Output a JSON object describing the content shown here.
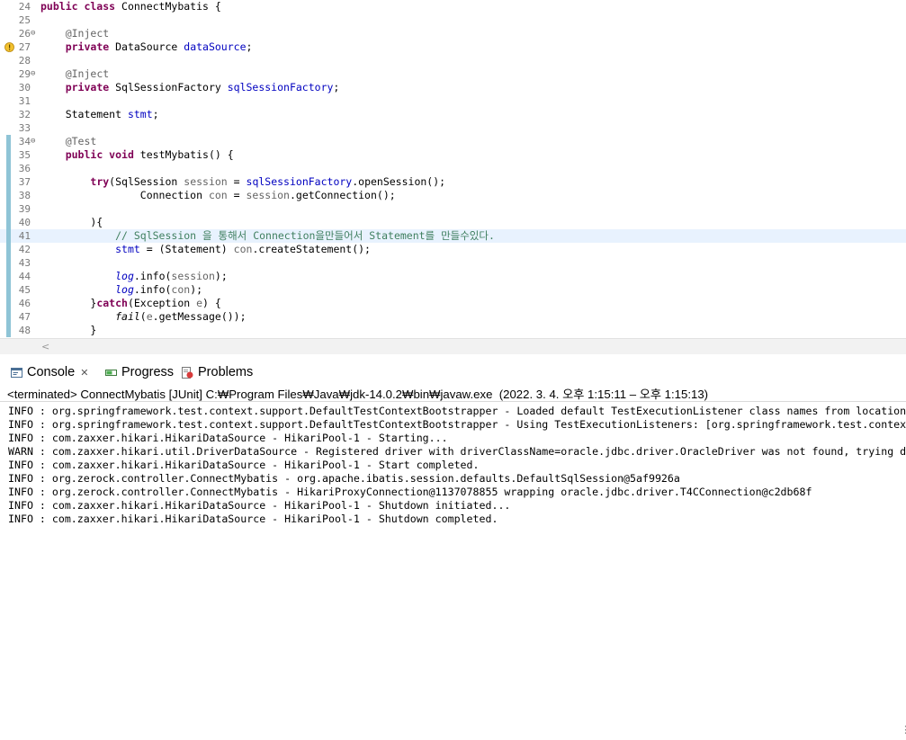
{
  "editor": {
    "lines": [
      {
        "n": "24",
        "parts": [
          {
            "t": "public class ",
            "c": "kw"
          },
          {
            "t": "ConnectMybatis {"
          }
        ]
      },
      {
        "n": "25",
        "parts": []
      },
      {
        "n": "26",
        "fold": "⊖",
        "parts": [
          {
            "t": "    "
          },
          {
            "t": "@Inject",
            "c": "ann"
          }
        ]
      },
      {
        "n": "27",
        "warn": true,
        "parts": [
          {
            "t": "    "
          },
          {
            "t": "private ",
            "c": "kw"
          },
          {
            "t": "DataSource "
          },
          {
            "t": "dataSource",
            "c": "fld"
          },
          {
            "t": ";"
          }
        ]
      },
      {
        "n": "28",
        "parts": []
      },
      {
        "n": "29",
        "fold": "⊖",
        "parts": [
          {
            "t": "    "
          },
          {
            "t": "@Inject",
            "c": "ann"
          }
        ]
      },
      {
        "n": "30",
        "parts": [
          {
            "t": "    "
          },
          {
            "t": "private ",
            "c": "kw"
          },
          {
            "t": "SqlSessionFactory "
          },
          {
            "t": "sqlSessionFactory",
            "c": "fld"
          },
          {
            "t": ";"
          }
        ]
      },
      {
        "n": "31",
        "parts": []
      },
      {
        "n": "32",
        "parts": [
          {
            "t": "    Statement "
          },
          {
            "t": "stmt",
            "c": "fld"
          },
          {
            "t": ";"
          }
        ]
      },
      {
        "n": "33",
        "parts": []
      },
      {
        "n": "34",
        "fold": "⊖",
        "mark": true,
        "parts": [
          {
            "t": "    "
          },
          {
            "t": "@Test",
            "c": "ann"
          }
        ]
      },
      {
        "n": "35",
        "mark": true,
        "parts": [
          {
            "t": "    "
          },
          {
            "t": "public void ",
            "c": "kw"
          },
          {
            "t": "testMybatis() {"
          }
        ]
      },
      {
        "n": "36",
        "mark": true,
        "parts": []
      },
      {
        "n": "37",
        "mark": true,
        "parts": [
          {
            "t": "        "
          },
          {
            "t": "try",
            "c": "kw"
          },
          {
            "t": "(SqlSession "
          },
          {
            "t": "session",
            "c": "ann"
          },
          {
            "t": " = "
          },
          {
            "t": "sqlSessionFactory",
            "c": "fld"
          },
          {
            "t": ".openSession();"
          }
        ]
      },
      {
        "n": "38",
        "mark": true,
        "parts": [
          {
            "t": "                Connection "
          },
          {
            "t": "con",
            "c": "ann"
          },
          {
            "t": " = "
          },
          {
            "t": "session",
            "c": "ann"
          },
          {
            "t": ".getConnection();"
          }
        ]
      },
      {
        "n": "39",
        "mark": true,
        "parts": []
      },
      {
        "n": "40",
        "mark": true,
        "parts": [
          {
            "t": "        ){"
          }
        ]
      },
      {
        "n": "41",
        "mark": true,
        "hl": true,
        "parts": [
          {
            "t": "            "
          },
          {
            "t": "// SqlSession 을 통해서 Connection을만들어서 Statement를 만들수있다.",
            "c": "cmt"
          }
        ]
      },
      {
        "n": "42",
        "mark": true,
        "parts": [
          {
            "t": "            "
          },
          {
            "t": "stmt",
            "c": "fld"
          },
          {
            "t": " = (Statement) "
          },
          {
            "t": "con",
            "c": "ann"
          },
          {
            "t": ".createStatement();"
          }
        ]
      },
      {
        "n": "43",
        "mark": true,
        "parts": []
      },
      {
        "n": "44",
        "mark": true,
        "parts": [
          {
            "t": "            "
          },
          {
            "t": "log",
            "c": "fld ital"
          },
          {
            "t": ".info("
          },
          {
            "t": "session",
            "c": "ann"
          },
          {
            "t": ");"
          }
        ]
      },
      {
        "n": "45",
        "mark": true,
        "parts": [
          {
            "t": "            "
          },
          {
            "t": "log",
            "c": "fld ital"
          },
          {
            "t": ".info("
          },
          {
            "t": "con",
            "c": "ann"
          },
          {
            "t": ");"
          }
        ]
      },
      {
        "n": "46",
        "mark": true,
        "parts": [
          {
            "t": "        }"
          },
          {
            "t": "catch",
            "c": "kw"
          },
          {
            "t": "(Exception "
          },
          {
            "t": "e",
            "c": "ann"
          },
          {
            "t": ") {"
          }
        ]
      },
      {
        "n": "47",
        "mark": true,
        "parts": [
          {
            "t": "            "
          },
          {
            "t": "fail",
            "c": "ital"
          },
          {
            "t": "("
          },
          {
            "t": "e",
            "c": "ann"
          },
          {
            "t": ".getMessage());"
          }
        ]
      },
      {
        "n": "48",
        "mark": true,
        "parts": [
          {
            "t": "        }"
          }
        ]
      }
    ]
  },
  "tabs": {
    "console": "Console",
    "progress": "Progress",
    "problems": "Problems"
  },
  "status": {
    "text": "<terminated> ConnectMybatis [JUnit] C:₩Program Files₩Java₩jdk-14.0.2₩bin₩javaw.exe  (2022. 3. 4. 오후 1:15:11 – 오후 1:15:13)"
  },
  "console": {
    "lines": [
      "INFO : org.springframework.test.context.support.DefaultTestContextBootstrapper - Loaded default TestExecutionListener class names from location",
      "INFO : org.springframework.test.context.support.DefaultTestContextBootstrapper - Using TestExecutionListeners: [org.springframework.test.contex",
      "INFO : com.zaxxer.hikari.HikariDataSource - HikariPool-1 - Starting...",
      "WARN : com.zaxxer.hikari.util.DriverDataSource - Registered driver with driverClassName=oracle.jdbc.driver.OracleDriver was not found, trying d",
      "INFO : com.zaxxer.hikari.HikariDataSource - HikariPool-1 - Start completed.",
      "INFO : org.zerock.controller.ConnectMybatis - org.apache.ibatis.session.defaults.DefaultSqlSession@5af9926a",
      "INFO : org.zerock.controller.ConnectMybatis - HikariProxyConnection@1137078855 wrapping oracle.jdbc.driver.T4CConnection@c2db68f",
      "INFO : com.zaxxer.hikari.HikariDataSource - HikariPool-1 - Shutdown initiated...",
      "INFO : com.zaxxer.hikari.HikariDataSource - HikariPool-1 - Shutdown completed."
    ]
  },
  "colors": {
    "keyword": "#7f0055",
    "annotation": "#646464",
    "field": "#0000c0",
    "comment": "#3f7f5f",
    "line_highlight": "#e8f2fe",
    "change_marker": "#8fc4d6"
  }
}
